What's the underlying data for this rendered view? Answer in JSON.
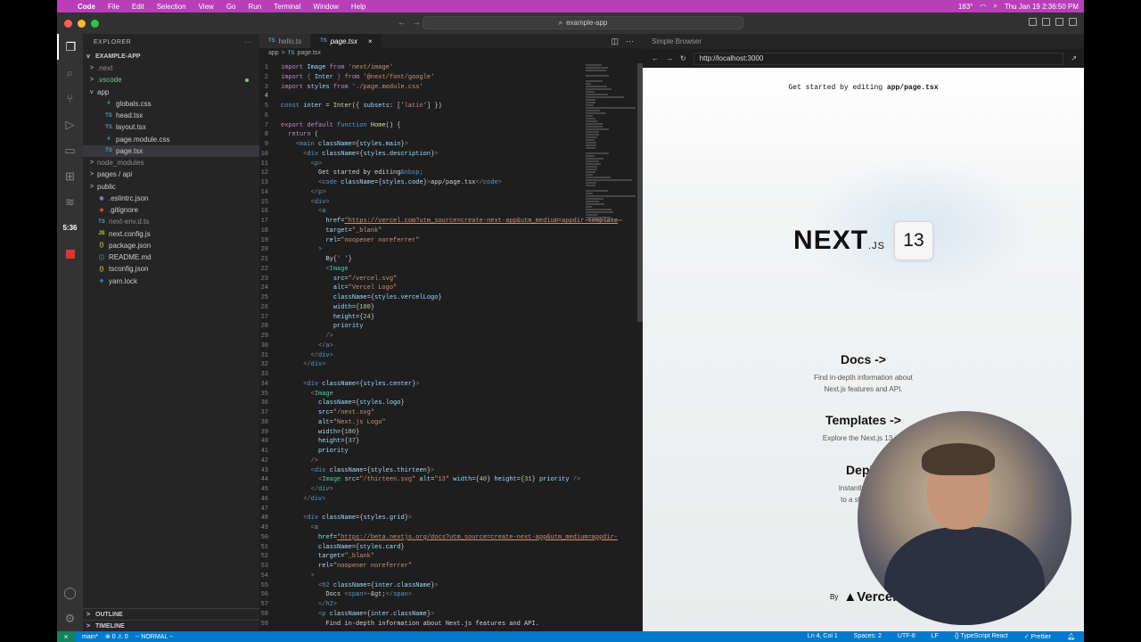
{
  "menubar": {
    "app": "Code",
    "items": [
      "File",
      "Edit",
      "Selection",
      "View",
      "Go",
      "Run",
      "Terminal",
      "Window",
      "Help"
    ],
    "temp": "183°",
    "clock": "Thu Jan 19  2:36:50 PM"
  },
  "titlebar": {
    "search": "example-app"
  },
  "activity": {
    "timer": "5:36"
  },
  "explorer": {
    "title": "EXPLORER",
    "root": "EXAMPLE-APP",
    "outline": "OUTLINE",
    "timeline": "TIMELINE",
    "rows": [
      {
        "indent": 1,
        "chev": ">",
        "icon": "",
        "label": ".next",
        "color": "#8b8b8b"
      },
      {
        "indent": 1,
        "chev": ">",
        "icon": "",
        "label": ".vscode",
        "color": "#73c991",
        "dot": true
      },
      {
        "indent": 1,
        "chev": "v",
        "icon": "",
        "label": "app",
        "color": "#ccc"
      },
      {
        "indent": 2,
        "chev": "",
        "icon": "#",
        "label": "globals.css",
        "color": "#ccc",
        "ic": "#519aba"
      },
      {
        "indent": 2,
        "chev": "",
        "icon": "TS",
        "label": "head.tsx",
        "color": "#ccc",
        "ic": "#519aba"
      },
      {
        "indent": 2,
        "chev": "",
        "icon": "TS",
        "label": "layout.tsx",
        "color": "#ccc",
        "ic": "#519aba"
      },
      {
        "indent": 2,
        "chev": "",
        "icon": "#",
        "label": "page.module.css",
        "color": "#ccc",
        "ic": "#519aba"
      },
      {
        "indent": 2,
        "chev": "",
        "icon": "TS",
        "label": "page.tsx",
        "color": "#ccc",
        "ic": "#519aba",
        "sel": true
      },
      {
        "indent": 1,
        "chev": ">",
        "icon": "",
        "label": "node_modules",
        "color": "#8b8b8b"
      },
      {
        "indent": 1,
        "chev": ">",
        "icon": "",
        "label": "pages / api",
        "color": "#ccc"
      },
      {
        "indent": 1,
        "chev": ">",
        "icon": "",
        "label": "public",
        "color": "#ccc"
      },
      {
        "indent": 1,
        "chev": "",
        "icon": "◉",
        "label": ".eslintrc.json",
        "color": "#ccc",
        "ic": "#a074c4"
      },
      {
        "indent": 1,
        "chev": "",
        "icon": "◆",
        "label": ".gitignore",
        "color": "#ccc",
        "ic": "#e64a19"
      },
      {
        "indent": 1,
        "chev": "",
        "icon": "TS",
        "label": "next-env.d.ts",
        "color": "#8b8b8b",
        "ic": "#519aba"
      },
      {
        "indent": 1,
        "chev": "",
        "icon": "JS",
        "label": "next.config.js",
        "color": "#ccc",
        "ic": "#cbcb41"
      },
      {
        "indent": 1,
        "chev": "",
        "icon": "{}",
        "label": "package.json",
        "color": "#ccc",
        "ic": "#cbcb41"
      },
      {
        "indent": 1,
        "chev": "",
        "icon": "ⓘ",
        "label": "README.md",
        "color": "#ccc",
        "ic": "#519aba"
      },
      {
        "indent": 1,
        "chev": "",
        "icon": "{}",
        "label": "tsconfig.json",
        "color": "#ccc",
        "ic": "#cbcb41"
      },
      {
        "indent": 1,
        "chev": "",
        "icon": "❖",
        "label": "yarn.lock",
        "color": "#ccc",
        "ic": "#2188b6"
      }
    ]
  },
  "editor": {
    "tabs": [
      {
        "label": "hello.ts",
        "active": false
      },
      {
        "label": "page.tsx",
        "active": true
      }
    ],
    "breadcrumb": [
      "app",
      ">",
      "page.tsx"
    ],
    "lines": [
      "<k>import</k> <v>Image</v> <k>from</k> <s>'next/image'</s>",
      "<k>import</k> <p>{</p> <v>Inter</v> <p>}</p> <k>from</k> <s>'@next/font/google'</s>",
      "<k>import</k> <v>styles</v> <k>from</k> <s>'./page.module.css'</s>",
      "",
      "<b>const</b> <v>inter</v> = <f>Inter</f>({ <a>subsets</a>: [<s>'latin'</s>] })",
      "",
      "<k>export</k> <k>default</k> <b>function</b> <f>Home</f>() {",
      "  <k>return</k> (",
      "    <p>&lt;</p><b>main</b> <a>className</a>={<v>styles</v>.<v>main</v>}<p>&gt;</p>",
      "      <p>&lt;</p><b>div</b> <a>className</a>={<v>styles</v>.<v>description</v>}<p>&gt;</p>",
      "        <p>&lt;</p><b>p</b><p>&gt;</p>",
      "          Get started by editing<b>&amp;nbsp;</b>",
      "          <p>&lt;</p><b>code</b> <a>className</a>={<v>styles</v>.<v>code</v>}<p>&gt;</p>app/page.tsx<p>&lt;/</p><b>code</b><p>&gt;</p>",
      "        <p>&lt;/</p><b>p</b><p>&gt;</p>",
      "        <p>&lt;</p><b>div</b><p>&gt;</p>",
      "          <p>&lt;</p><b>a</b>",
      "            <a>href</a>=<u>\"https://vercel.com?utm_source=create-next-app&amp;utm_medium=appdir-template</u>",
      "            <a>target</a>=<s>\"_blank\"</s>",
      "            <a>rel</a>=<s>\"noopener noreferrer\"</s>",
      "          <p>&gt;</p>",
      "            By{<s>' '</s>}",
      "            <p>&lt;</p><t>Image</t>",
      "              <a>src</a>=<s>\"/vercel.svg\"</s>",
      "              <a>alt</a>=<s>\"Vercel Logo\"</s>",
      "              <a>className</a>={<v>styles</v>.<v>vercelLogo</v>}",
      "              <a>width</a>={<n>100</n>}",
      "              <a>height</a>={<n>24</n>}",
      "              <a>priority</a>",
      "            <p>/&gt;</p>",
      "          <p>&lt;/</p><b>a</b><p>&gt;</p>",
      "        <p>&lt;/</p><b>div</b><p>&gt;</p>",
      "      <p>&lt;/</p><b>div</b><p>&gt;</p>",
      "",
      "      <p>&lt;</p><b>div</b> <a>className</a>={<v>styles</v>.<v>center</v>}<p>&gt;</p>",
      "        <p>&lt;</p><t>Image</t>",
      "          <a>className</a>={<v>styles</v>.<v>logo</v>}",
      "          <a>src</a>=<s>\"/next.svg\"</s>",
      "          <a>alt</a>=<s>\"Next.js Logo\"</s>",
      "          <a>width</a>={<n>180</n>}",
      "          <a>height</a>={<n>37</n>}",
      "          <a>priority</a>",
      "        <p>/&gt;</p>",
      "        <p>&lt;</p><b>div</b> <a>className</a>={<v>styles</v>.<v>thirteen</v>}<p>&gt;</p>",
      "          <p>&lt;</p><t>Image</t> <a>src</a>=<s>\"/thirteen.svg\"</s> <a>alt</a>=<s>\"13\"</s> <a>width</a>={<n>40</n>} <a>height</a>={<n>31</n>} <a>priority</a> <p>/&gt;</p>",
      "        <p>&lt;/</p><b>div</b><p>&gt;</p>",
      "      <p>&lt;/</p><b>div</b><p>&gt;</p>",
      "",
      "      <p>&lt;</p><b>div</b> <a>className</a>={<v>styles</v>.<v>grid</v>}<p>&gt;</p>",
      "        <p>&lt;</p><b>a</b>",
      "          <a>href</a>=<u>\"https://beta.nextjs.org/docs?utm_source=create-next-app&amp;utm_medium=appdir-</u>",
      "          <a>className</a>={<v>styles</v>.<v>card</v>}",
      "          <a>target</a>=<s>\"_blank\"</s>",
      "          <a>rel</a>=<s>\"noopener noreferrer\"</s>",
      "        <p>&gt;</p>",
      "          <p>&lt;</p><b>h2</b> <a>className</a>={<v>inter</v>.<v>className</v>}<p>&gt;</p>",
      "            Docs <p>&lt;</p><b>span</b><p>&gt;</p>-&amp;gt;<p>&lt;/</p><b>span</b><p>&gt;</p>",
      "          <p>&lt;/</p><b>h2</b><p>&gt;</p>",
      "          <p>&lt;</p><b>p</b> <a>className</a>={<v>inter</v>.<v>className</v>}<p>&gt;</p>",
      "            Find in-depth information about Next.js features and API."
    ]
  },
  "browser": {
    "tab": "Simple Browser",
    "url": "http://localhost:3000",
    "get_started": "Get started by editing",
    "get_started_file": "app/page.tsx",
    "logo_text": "NEXT",
    "logo_suffix": ".JS",
    "badge": "13",
    "cards": [
      {
        "title": "Docs ->",
        "desc": "Find in-depth information about",
        "desc2": "Next.js features and API."
      },
      {
        "title": "Templates ->",
        "desc": "Explore the Next.js 13 pla",
        "desc2": ""
      },
      {
        "title": "Deplo",
        "desc": "Instantly deploy",
        "desc2": "to a shareable"
      }
    ],
    "by": "By",
    "vercel": "▲Vercel"
  },
  "statusbar": {
    "branch": "main*",
    "errors": "⊗ 0 ⚠ 0",
    "mode": "-- NORMAL --",
    "pos": "Ln 4, Col 1",
    "spaces": "Spaces: 2",
    "enc": "UTF-8",
    "eol": "LF",
    "lang": "{} TypeScript React",
    "prettier": "✓ Prettier"
  }
}
